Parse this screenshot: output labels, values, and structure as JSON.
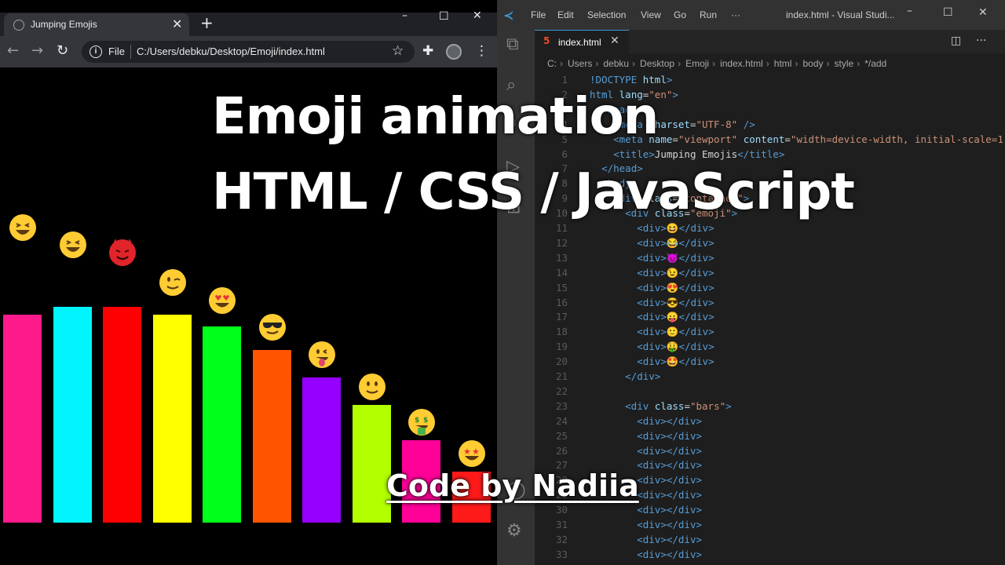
{
  "browser": {
    "tab_title": "Jumping Emojis",
    "url_scheme": "File",
    "url": "C:/Users/debku/Desktop/Emoji/index.html"
  },
  "bars": [
    {
      "color": "#ff1a8c",
      "level": 0.53
    },
    {
      "color": "#00f5ff",
      "level": 0.55
    },
    {
      "color": "#ff0000",
      "level": 0.55
    },
    {
      "color": "#ffff00",
      "level": 0.53
    },
    {
      "color": "#00ff1a",
      "level": 0.5
    },
    {
      "color": "#ff5500",
      "level": 0.44
    },
    {
      "color": "#9500ff",
      "level": 0.37
    },
    {
      "color": "#b2ff00",
      "level": 0.3
    },
    {
      "color": "#ff0099",
      "level": 0.21
    },
    {
      "color": "#ff1a1a",
      "level": 0.13
    }
  ],
  "emojis": [
    {
      "name": "grinning-squint-emoji",
      "kind": "grin"
    },
    {
      "name": "joy-emoji",
      "kind": "joy"
    },
    {
      "name": "smiling-devil-emoji",
      "kind": "devil"
    },
    {
      "name": "wink-emoji",
      "kind": "wink"
    },
    {
      "name": "heart-eyes-emoji",
      "kind": "hearts"
    },
    {
      "name": "sunglasses-emoji",
      "kind": "cool"
    },
    {
      "name": "tongue-emoji",
      "kind": "tongue"
    },
    {
      "name": "slight-smile-emoji",
      "kind": "smile"
    },
    {
      "name": "money-mouth-emoji",
      "kind": "money"
    },
    {
      "name": "star-struck-emoji",
      "kind": "stars"
    }
  ],
  "vscode": {
    "menu": [
      "File",
      "Edit",
      "Selection",
      "View",
      "Go",
      "Run",
      "···"
    ],
    "window_title": "index.html - Visual Studi...",
    "tab": "index.html",
    "breadcrumb": [
      "C:",
      "Users",
      "debku",
      "Desktop",
      "Emoji",
      "index.html",
      "html",
      "body",
      "style",
      "*/add"
    ],
    "lines": [
      {
        "n": "1",
        "parts": [
          [
            "tg",
            "!DOCTYPE"
          ],
          [
            "tx",
            " "
          ],
          [
            "at",
            "html"
          ],
          [
            "tg",
            ">"
          ]
        ]
      },
      {
        "n": "2",
        "parts": [
          [
            "tg",
            "html "
          ],
          [
            "at",
            "lang"
          ],
          [
            "tx",
            "="
          ],
          [
            "st",
            "\"en\""
          ],
          [
            "tg",
            ">"
          ]
        ]
      },
      {
        "n": "3",
        "parts": [
          [
            "tx",
            "  "
          ],
          [
            "tg",
            "<head>"
          ]
        ]
      },
      {
        "n": "4",
        "parts": [
          [
            "tx",
            "    "
          ],
          [
            "tg",
            "<meta "
          ],
          [
            "at",
            "charset"
          ],
          [
            "tx",
            "="
          ],
          [
            "st",
            "\"UTF-8\""
          ],
          [
            "tg",
            " />"
          ]
        ]
      },
      {
        "n": "5",
        "parts": [
          [
            "tx",
            "    "
          ],
          [
            "tg",
            "<meta "
          ],
          [
            "at",
            "name"
          ],
          [
            "tx",
            "="
          ],
          [
            "st",
            "\"viewport\""
          ],
          [
            "at",
            " content"
          ],
          [
            "tx",
            "="
          ],
          [
            "st",
            "\"width=device-width, initial-scale=1"
          ]
        ]
      },
      {
        "n": "6",
        "parts": [
          [
            "tx",
            "    "
          ],
          [
            "tg",
            "<title>"
          ],
          [
            "tx",
            "Jumping Emojis"
          ],
          [
            "tg",
            "</title>"
          ]
        ]
      },
      {
        "n": "7",
        "parts": [
          [
            "tx",
            "  "
          ],
          [
            "tg",
            "</head>"
          ]
        ]
      },
      {
        "n": "8",
        "parts": [
          [
            "tx",
            "  "
          ],
          [
            "tg",
            "<body>"
          ]
        ]
      },
      {
        "n": "9",
        "parts": [
          [
            "tx",
            "    "
          ],
          [
            "tg",
            "<div "
          ],
          [
            "at",
            "class"
          ],
          [
            "tx",
            "="
          ],
          [
            "st",
            "\"container\""
          ],
          [
            "tg",
            ">"
          ]
        ]
      },
      {
        "n": "10",
        "parts": [
          [
            "tx",
            "      "
          ],
          [
            "tg",
            "<div "
          ],
          [
            "at",
            "class"
          ],
          [
            "tx",
            "="
          ],
          [
            "st",
            "\"emoji\""
          ],
          [
            "tg",
            ">"
          ]
        ]
      },
      {
        "n": "11",
        "parts": [
          [
            "tx",
            "        "
          ],
          [
            "tg",
            "<div>"
          ],
          [
            "tx",
            "😆"
          ],
          [
            "tg",
            "</div>"
          ]
        ]
      },
      {
        "n": "12",
        "parts": [
          [
            "tx",
            "        "
          ],
          [
            "tg",
            "<div>"
          ],
          [
            "tx",
            "😂"
          ],
          [
            "tg",
            "</div>"
          ]
        ]
      },
      {
        "n": "13",
        "parts": [
          [
            "tx",
            "        "
          ],
          [
            "tg",
            "<div>"
          ],
          [
            "tx",
            "😈"
          ],
          [
            "tg",
            "</div>"
          ]
        ]
      },
      {
        "n": "14",
        "parts": [
          [
            "tx",
            "        "
          ],
          [
            "tg",
            "<div>"
          ],
          [
            "tx",
            "😉"
          ],
          [
            "tg",
            "</div>"
          ]
        ]
      },
      {
        "n": "15",
        "parts": [
          [
            "tx",
            "        "
          ],
          [
            "tg",
            "<div>"
          ],
          [
            "tx",
            "😍"
          ],
          [
            "tg",
            "</div>"
          ]
        ]
      },
      {
        "n": "16",
        "parts": [
          [
            "tx",
            "        "
          ],
          [
            "tg",
            "<div>"
          ],
          [
            "tx",
            "😎"
          ],
          [
            "tg",
            "</div>"
          ]
        ]
      },
      {
        "n": "17",
        "parts": [
          [
            "tx",
            "        "
          ],
          [
            "tg",
            "<div>"
          ],
          [
            "tx",
            "😛"
          ],
          [
            "tg",
            "</div>"
          ]
        ]
      },
      {
        "n": "18",
        "parts": [
          [
            "tx",
            "        "
          ],
          [
            "tg",
            "<div>"
          ],
          [
            "tx",
            "🙂"
          ],
          [
            "tg",
            "</div>"
          ]
        ]
      },
      {
        "n": "19",
        "parts": [
          [
            "tx",
            "        "
          ],
          [
            "tg",
            "<div>"
          ],
          [
            "tx",
            "🤑"
          ],
          [
            "tg",
            "</div>"
          ]
        ]
      },
      {
        "n": "20",
        "parts": [
          [
            "tx",
            "        "
          ],
          [
            "tg",
            "<div>"
          ],
          [
            "tx",
            "🤩"
          ],
          [
            "tg",
            "</div>"
          ]
        ]
      },
      {
        "n": "21",
        "parts": [
          [
            "tx",
            "      "
          ],
          [
            "tg",
            "</div>"
          ]
        ]
      },
      {
        "n": "22",
        "parts": []
      },
      {
        "n": "23",
        "parts": [
          [
            "tx",
            "      "
          ],
          [
            "tg",
            "<div "
          ],
          [
            "at",
            "class"
          ],
          [
            "tx",
            "="
          ],
          [
            "st",
            "\"bars\""
          ],
          [
            "tg",
            ">"
          ]
        ]
      },
      {
        "n": "24",
        "parts": [
          [
            "tx",
            "        "
          ],
          [
            "tg",
            "<div></div>"
          ]
        ]
      },
      {
        "n": "25",
        "parts": [
          [
            "tx",
            "        "
          ],
          [
            "tg",
            "<div></div>"
          ]
        ]
      },
      {
        "n": "26",
        "parts": [
          [
            "tx",
            "        "
          ],
          [
            "tg",
            "<div></div>"
          ]
        ]
      },
      {
        "n": "27",
        "parts": [
          [
            "tx",
            "        "
          ],
          [
            "tg",
            "<div></div>"
          ]
        ]
      },
      {
        "n": "28",
        "parts": [
          [
            "tx",
            "        "
          ],
          [
            "tg",
            "<div></div>"
          ]
        ]
      },
      {
        "n": "29",
        "parts": [
          [
            "tx",
            "        "
          ],
          [
            "tg",
            "<div></div>"
          ]
        ]
      },
      {
        "n": "30",
        "parts": [
          [
            "tx",
            "        "
          ],
          [
            "tg",
            "<div></div>"
          ]
        ]
      },
      {
        "n": "31",
        "parts": [
          [
            "tx",
            "        "
          ],
          [
            "tg",
            "<div></div>"
          ]
        ]
      },
      {
        "n": "32",
        "parts": [
          [
            "tx",
            "        "
          ],
          [
            "tg",
            "<div></div>"
          ]
        ]
      },
      {
        "n": "33",
        "parts": [
          [
            "tx",
            "        "
          ],
          [
            "tg",
            "<div></div>"
          ]
        ]
      }
    ]
  },
  "overlay": {
    "title_line1": "Emoji animation",
    "title_line2": "HTML / CSS / JavaScript",
    "credit": "Code by Nadiia"
  }
}
